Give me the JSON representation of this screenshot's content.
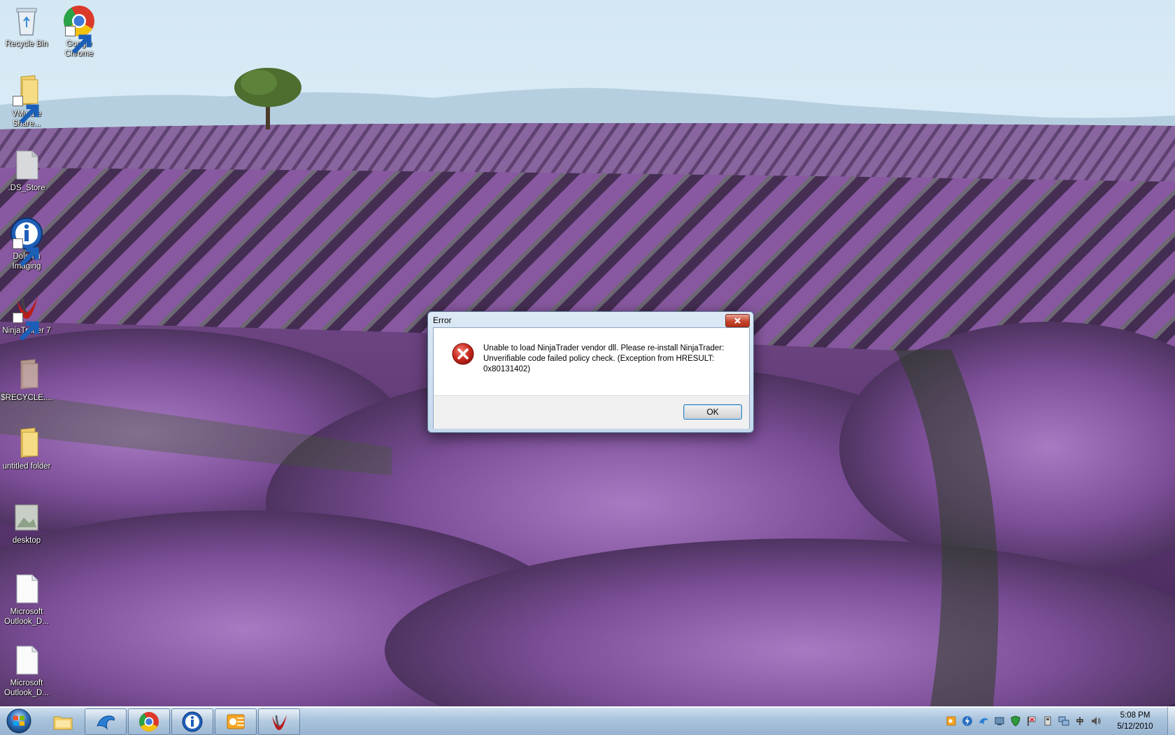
{
  "desktop": {
    "icons": [
      {
        "label": "Recycle Bin"
      },
      {
        "label": "Google Chrome"
      },
      {
        "label": "VMware Share..."
      },
      {
        "label": ".DS_Store"
      },
      {
        "label": "Dolphin Imaging"
      },
      {
        "label": "NinjaTrader 7"
      },
      {
        "label": "$RECYCLE...."
      },
      {
        "label": "untitled folder"
      },
      {
        "label": "desktop"
      },
      {
        "label": "Microsoft Outlook_D..."
      },
      {
        "label": "Microsoft Outlook_D..."
      }
    ]
  },
  "dialog": {
    "title": "Error",
    "message": "Unable to load NinjaTrader vendor dll. Please re-install NinjaTrader: Unverifiable code failed policy check. (Exception from HRESULT: 0x80131402)",
    "ok_label": "OK",
    "icon": "error-icon"
  },
  "taskbar": {
    "start": "windows-start-icon",
    "items": [
      {
        "name": "windows-explorer-icon",
        "running": false
      },
      {
        "name": "dolphin-icon",
        "running": true
      },
      {
        "name": "chrome-icon",
        "running": true
      },
      {
        "name": "dolphin-imaging-icon",
        "running": true
      },
      {
        "name": "outlook-icon",
        "running": true
      },
      {
        "name": "ninjatrader-icon",
        "running": true
      }
    ],
    "clock": {
      "time": "5:08 PM",
      "date": "5/12/2010"
    }
  },
  "colors": {
    "sky": "#d9ebf5",
    "lavender": "#7a4a8c",
    "error_red": "#c8281e",
    "taskbar": "#a9c3dc"
  }
}
